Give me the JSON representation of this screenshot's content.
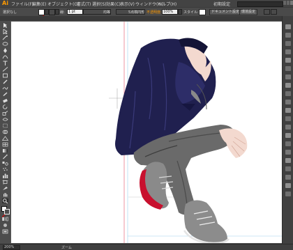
{
  "app": {
    "logo": "Ai"
  },
  "menu": {
    "items": [
      "ファイル(F)",
      "編集(E)",
      "オブジェクト(O)",
      "書式(T)",
      "選択(S)",
      "効果(C)",
      "表示(V)",
      "ウィンドウ(W)",
      "ヘルプ(H)"
    ],
    "workspace": "初期設定",
    "search_placeholder": ""
  },
  "control_bar": {
    "selection_label": "選択なし",
    "stroke_label": "線:",
    "stroke_weight": "1 pt",
    "brush_label": "均等",
    "brush_style": "5点楕円形",
    "opacity_label": "不透明度:",
    "opacity_value": "100%",
    "style_label": "スタイル:",
    "doc_setup_button": "ドキュメント設定",
    "prefs_button": "環境設定"
  },
  "status_bar": {
    "zoom": "200%",
    "tool_name": "ズーム"
  },
  "colors": {
    "accent": "#ff9a00",
    "hoodie": "#20204f",
    "pants": "#6a6a6a",
    "shoe_sole": "#c8102e",
    "guide": "#e87a8a"
  }
}
